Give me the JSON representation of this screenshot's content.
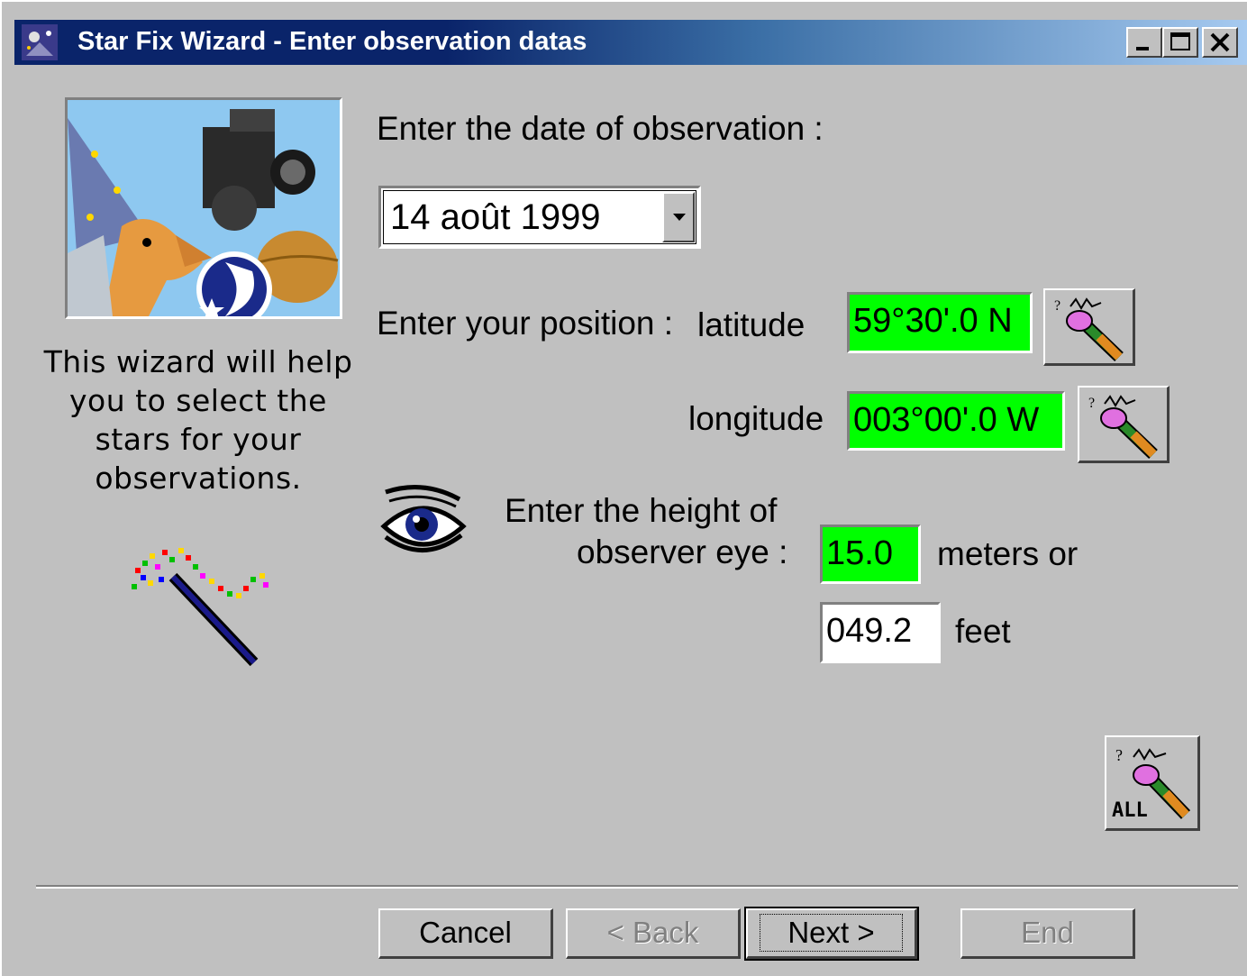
{
  "window": {
    "title": "Star Fix Wizard - Enter observation datas",
    "app_icon": "star-fix-app-icon",
    "controls": {
      "minimize_icon": "minimize-icon",
      "maximize_icon": "maximize-icon",
      "close_icon": "close-icon"
    }
  },
  "sidebar": {
    "description_lines": [
      "This wizard will help",
      "you to select the",
      "stars for your",
      "observations."
    ],
    "illustration": "wizard-illustration",
    "wand_icon": "magic-wand-icon"
  },
  "date": {
    "label": "Enter the date of observation :",
    "selected_value": "14 août 1999"
  },
  "position": {
    "label": "Enter your position :",
    "latitude_label": "latitude",
    "latitude_value": "59°30'.0 N",
    "longitude_label": "longitude",
    "longitude_value": "003°00'.0 W",
    "gps_button_icon": "gps-pen-icon"
  },
  "height": {
    "label_line1": "Enter the height of",
    "label_line2": "observer eye :",
    "eye_icon": "eye-icon",
    "meters_value": "15.0",
    "meters_unit": "meters or",
    "feet_value": "049.2",
    "feet_unit": "feet"
  },
  "all_button": {
    "text": "ALL",
    "icon": "gps-pen-all-icon"
  },
  "buttons": {
    "cancel": "Cancel",
    "back": "< Back",
    "next": "Next >",
    "end": "End"
  },
  "colors": {
    "title_bar_start": "#0a246a",
    "title_bar_end": "#a6caf0",
    "dialog_background": "#c0c0c0",
    "field_highlight": "#00ff00"
  }
}
